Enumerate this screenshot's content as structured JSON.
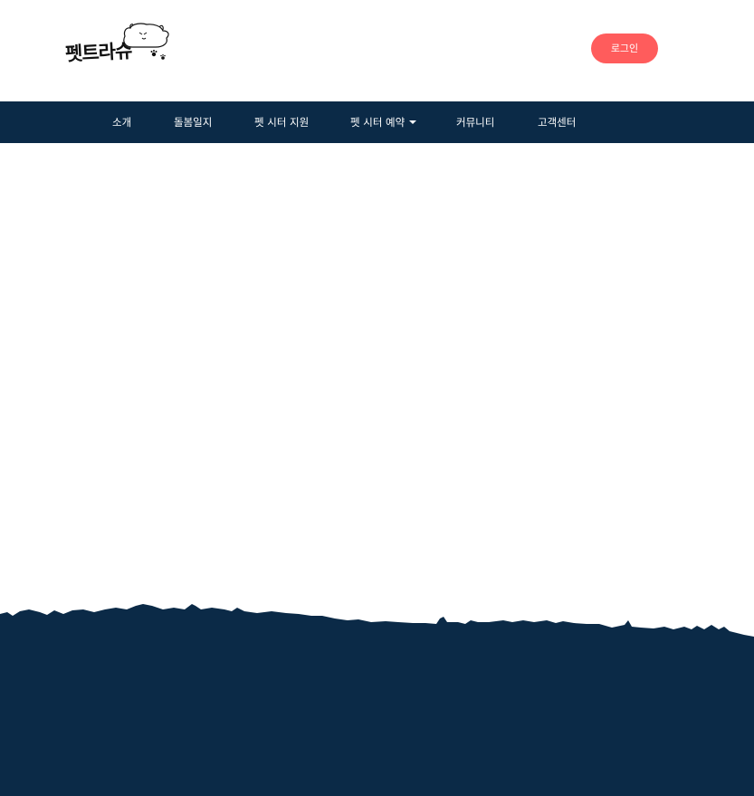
{
  "header": {
    "logo_text": "펫트라슈",
    "login_label": "로그인"
  },
  "nav": {
    "items": [
      {
        "label": "소개"
      },
      {
        "label": "돌봄일지"
      },
      {
        "label": "펫 시터 지원"
      },
      {
        "label": "펫 시터 예약"
      },
      {
        "label": "커뮤니티"
      },
      {
        "label": "고객센터"
      }
    ]
  },
  "colors": {
    "navy": "#0b2a47",
    "login_accent": "#ff5c5c",
    "background": "#ffffff"
  },
  "icons": {
    "logo_mascot": "dog-face-icon",
    "logo_paw": "paw-icon",
    "dropdown": "caret-down-icon"
  }
}
